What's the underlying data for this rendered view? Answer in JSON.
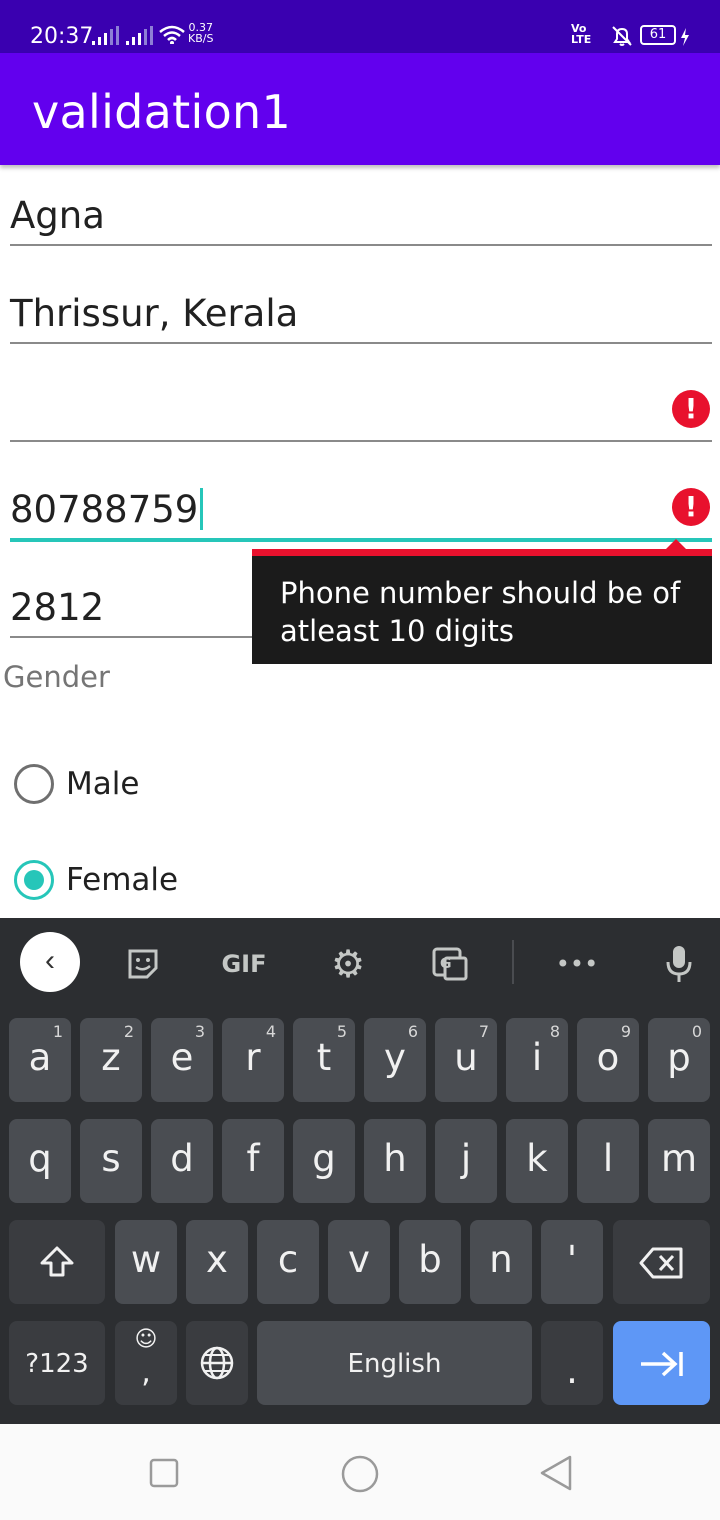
{
  "status_bar": {
    "time": "20:37",
    "speed_value": "0.37",
    "speed_unit": "KB/S",
    "volte_top": "Vo",
    "volte_bottom": "LTE",
    "battery": "61"
  },
  "app_bar": {
    "title": "validation1"
  },
  "form": {
    "name_value": "Agna",
    "address_value": "Thrissur, Kerala",
    "email_value": "",
    "phone_value": "80788759",
    "pin_value": "2812",
    "error_message": "Phone number should be of atleast 10 digits",
    "error_glyph": "!",
    "gender_label": "Gender",
    "gender_options": [
      "Male",
      "Female"
    ],
    "gender_selected": "Female"
  },
  "keyboard": {
    "toolbar": {
      "gif_label": "GIF",
      "more_label": "•••"
    },
    "row1": [
      {
        "l": "a",
        "n": "1"
      },
      {
        "l": "z",
        "n": "2"
      },
      {
        "l": "e",
        "n": "3"
      },
      {
        "l": "r",
        "n": "4"
      },
      {
        "l": "t",
        "n": "5"
      },
      {
        "l": "y",
        "n": "6"
      },
      {
        "l": "u",
        "n": "7"
      },
      {
        "l": "i",
        "n": "8"
      },
      {
        "l": "o",
        "n": "9"
      },
      {
        "l": "p",
        "n": "0"
      }
    ],
    "row2": [
      "q",
      "s",
      "d",
      "f",
      "g",
      "h",
      "j",
      "k",
      "l",
      "m"
    ],
    "row3": [
      "w",
      "x",
      "c",
      "v",
      "b",
      "n",
      "'"
    ],
    "symbols_label": "?123",
    "comma_label": ",",
    "space_label": "English",
    "period_label": "."
  },
  "colors": {
    "accent": "#26c6b9",
    "primary": "#6200ee",
    "status_bar": "#3a00b0",
    "error": "#e8112d",
    "enter_key": "#5e97f6"
  }
}
